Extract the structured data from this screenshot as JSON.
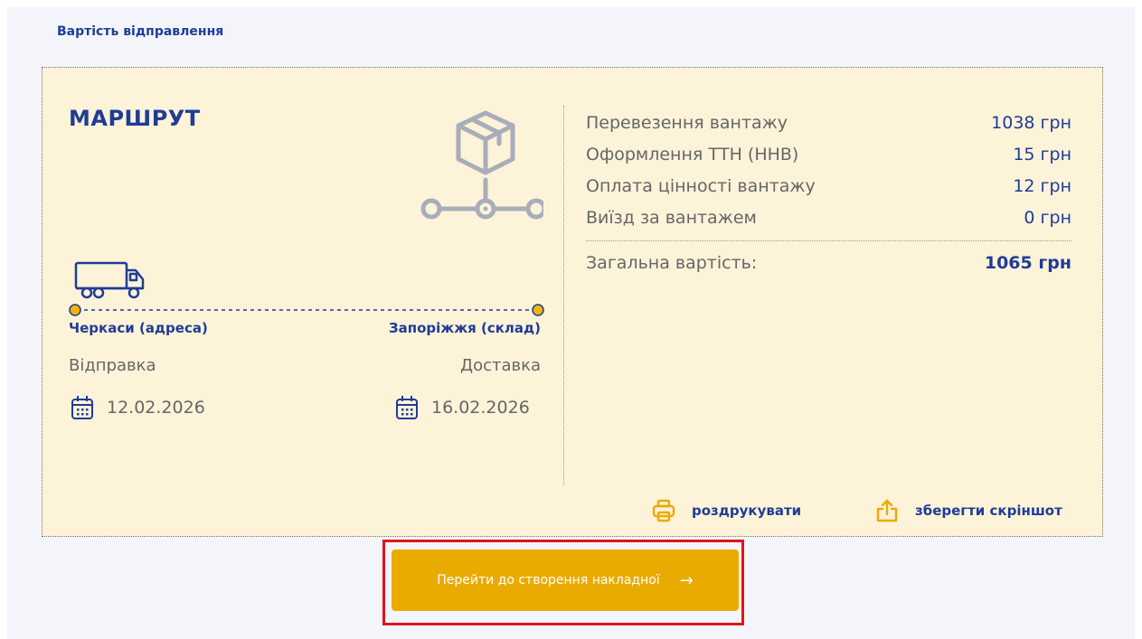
{
  "section_title": "Вартість відправлення",
  "route": {
    "title": "МАРШРУТ",
    "from_city": "Черкаси (адреса)",
    "to_city": "Запоріжжя (склад)",
    "from_label": "Відправка",
    "to_label": "Доставка",
    "from_date": "12.02.2026",
    "to_date": "16.02.2026"
  },
  "costs": {
    "items": [
      {
        "label": "Перевезення вантажу",
        "value": "1038 грн"
      },
      {
        "label": "Оформлення ТТН (ННВ)",
        "value": "15 грн"
      },
      {
        "label": "Оплата цінності вантажу",
        "value": "12 грн"
      },
      {
        "label": "Виїзд за вантажем",
        "value": "0 грн"
      }
    ],
    "total_label": "Загальна вартість:",
    "total_value": "1065 грн"
  },
  "actions": {
    "print_label": "роздрукувати",
    "save_label": "зберегти скріншот"
  },
  "cta": {
    "label": "Перейти до створення накладної",
    "arrow": "→"
  },
  "colors": {
    "brand_blue": "#1f3c96",
    "accent_yellow": "#eaab00",
    "card_bg": "#fdf3d9",
    "highlight_red": "#e0141b"
  },
  "icons": {
    "box": "package-icon",
    "truck": "truck-icon",
    "calendar": "calendar-icon",
    "print": "printer-icon",
    "share": "share-upload-icon"
  }
}
